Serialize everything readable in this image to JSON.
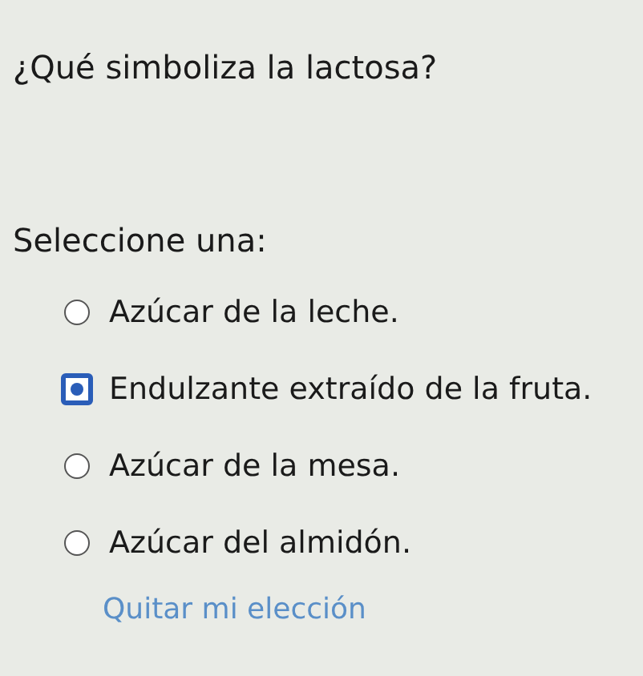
{
  "question": "¿Qué simboliza la lactosa?",
  "prompt": "Seleccione una:",
  "options": [
    {
      "label": "Azúcar de la leche.",
      "selected": false
    },
    {
      "label": "Endulzante extraído de la fruta.",
      "selected": true
    },
    {
      "label": "Azúcar de la mesa.",
      "selected": false
    },
    {
      "label": "Azúcar del almidón.",
      "selected": false
    }
  ],
  "clear_link": "Quitar mi elección"
}
